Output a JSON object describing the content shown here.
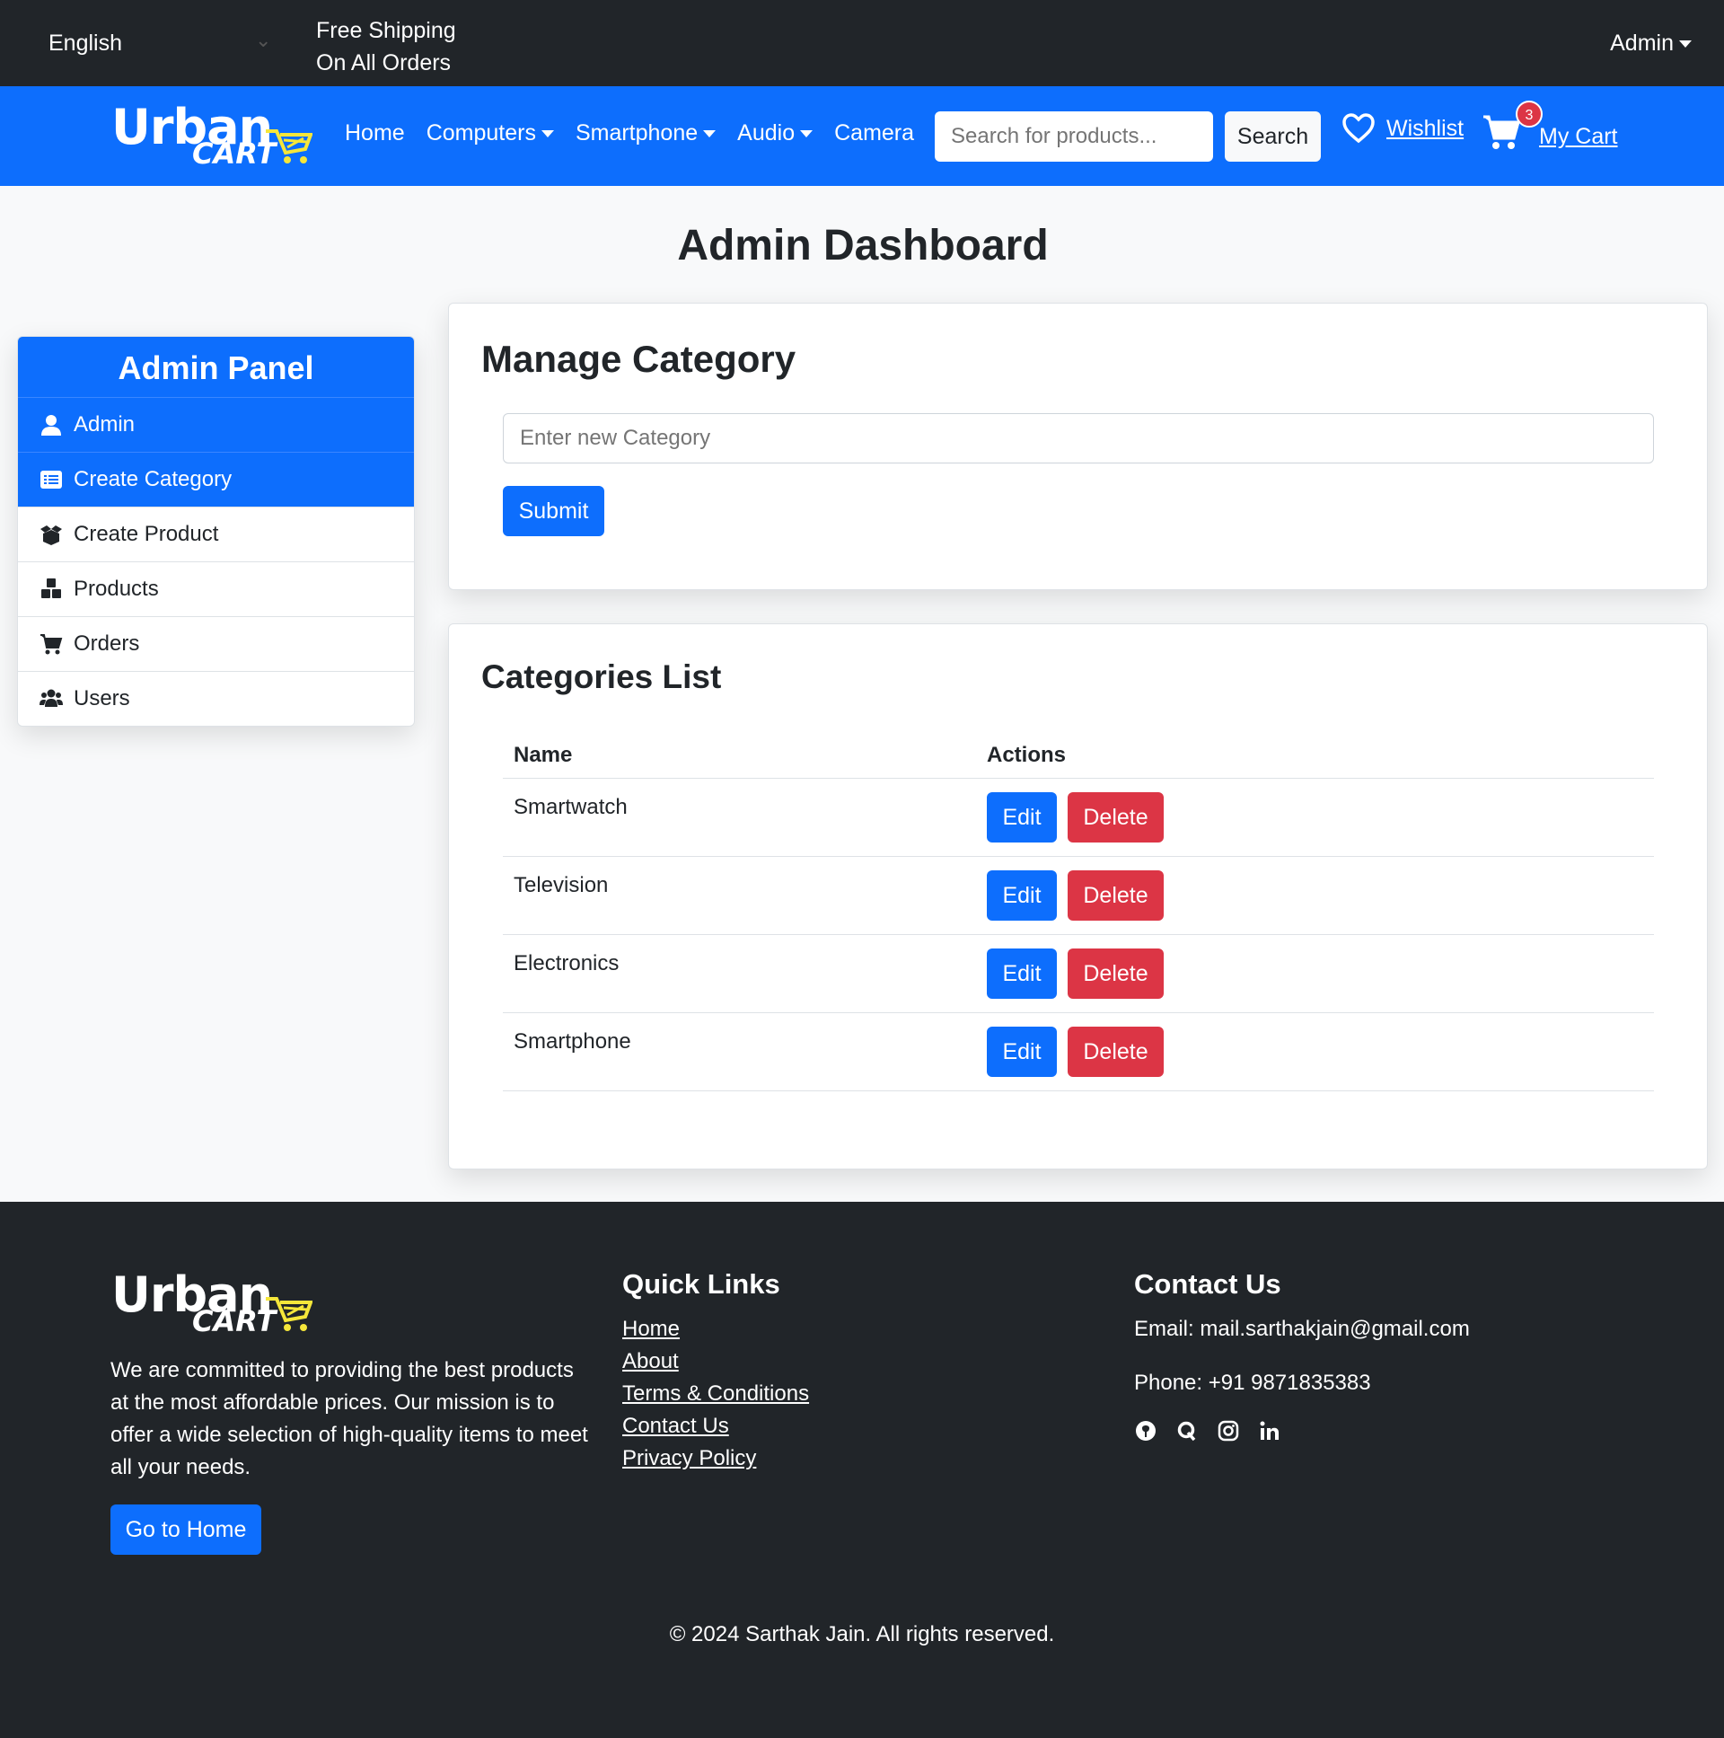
{
  "topbar": {
    "language": "English",
    "shipping_line1": "Free Shipping",
    "shipping_line2": "On All Orders",
    "user_menu": "Admin"
  },
  "brand": {
    "logo_top": "Urban",
    "logo_bottom": "CART"
  },
  "nav": {
    "links": [
      "Home",
      "Computers",
      "Smartphone",
      "Audio",
      "Camera"
    ],
    "search_placeholder": "Search for products...",
    "search_button": "Search",
    "wishlist": "Wishlist",
    "cart": "My Cart",
    "cart_count": "3"
  },
  "page": {
    "title": "Admin Dashboard"
  },
  "sidebar": {
    "title": "Admin Panel",
    "items": [
      {
        "label": "Admin",
        "icon": "user-icon",
        "active": true
      },
      {
        "label": "Create Category",
        "icon": "list-icon",
        "active": true
      },
      {
        "label": "Create Product",
        "icon": "box-open-icon",
        "active": false
      },
      {
        "label": "Products",
        "icon": "cubes-icon",
        "active": false
      },
      {
        "label": "Orders",
        "icon": "cart-icon",
        "active": false
      },
      {
        "label": "Users",
        "icon": "users-icon",
        "active": false
      }
    ]
  },
  "manage": {
    "title": "Manage Category",
    "input_placeholder": "Enter new Category",
    "submit": "Submit"
  },
  "list": {
    "title": "Categories List",
    "headers": [
      "Name",
      "Actions"
    ],
    "rows": [
      "Smartwatch",
      "Television",
      "Electronics",
      "Smartphone"
    ],
    "edit": "Edit",
    "delete": "Delete"
  },
  "footer": {
    "about": "We are committed to providing the best products at the most affordable prices. Our mission is to offer a wide selection of high-quality items to meet all your needs.",
    "home_button": "Go to Home",
    "quick_links_title": "Quick Links",
    "quick_links": [
      "Home",
      "About",
      "Terms & Conditions",
      "Contact Us",
      "Privacy Policy"
    ],
    "contact_title": "Contact Us",
    "email": "Email: mail.sarthakjain@gmail.com",
    "phone": "Phone: +91 9871835383",
    "socials": [
      "github-icon",
      "quora-icon",
      "instagram-icon",
      "linkedin-icon"
    ],
    "copyright": "© 2024 Sarthak Jain. All rights reserved."
  },
  "colors": {
    "primary": "#0d6efd",
    "danger": "#dc3545",
    "dark": "#212529",
    "logo_accent": "#f5e63a"
  }
}
